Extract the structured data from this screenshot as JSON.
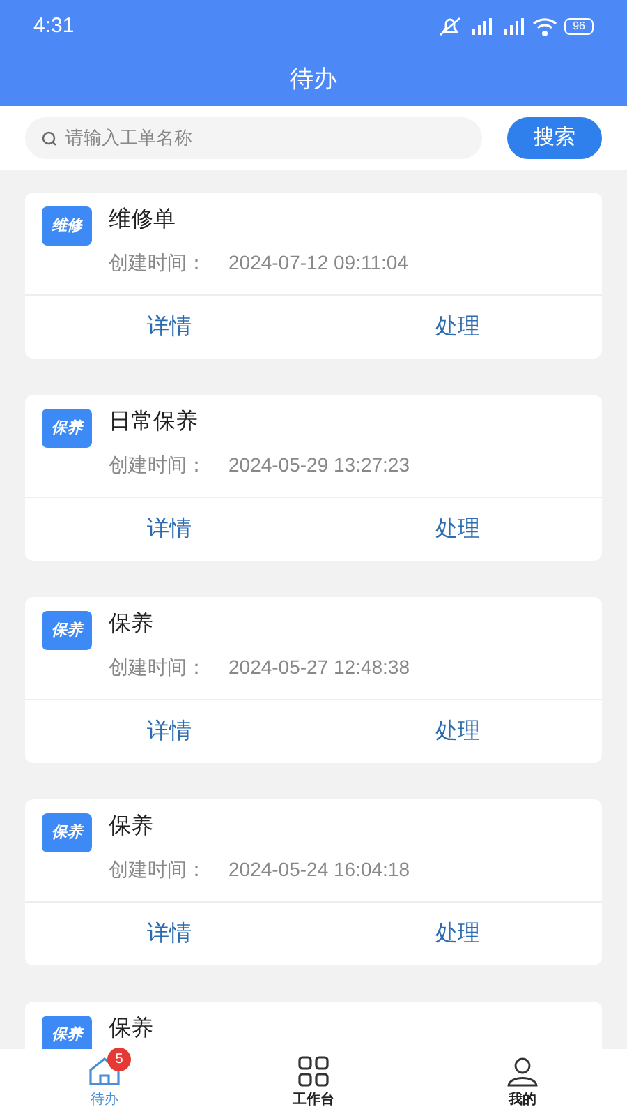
{
  "status_bar": {
    "time": "4:31",
    "battery": "96"
  },
  "header": {
    "title": "待办"
  },
  "search": {
    "placeholder": "请输入工单名称",
    "button": "搜索"
  },
  "orders": [
    {
      "badge": "维修",
      "title": "维修单",
      "created_label": "创建时间：",
      "created": "2024-07-12 09:11:04",
      "actions": [
        "详情",
        "处理"
      ]
    },
    {
      "badge": "保养",
      "title": "日常保养",
      "created_label": "创建时间：",
      "created": "2024-05-29 13:27:23",
      "actions": [
        "详情",
        "处理"
      ]
    },
    {
      "badge": "保养",
      "title": "保养",
      "created_label": "创建时间：",
      "created": "2024-05-27 12:48:38",
      "actions": [
        "详情",
        "处理"
      ]
    },
    {
      "badge": "保养",
      "title": "保养",
      "created_label": "创建时间：",
      "created": "2024-05-24 16:04:18",
      "actions": [
        "详情",
        "处理"
      ]
    },
    {
      "badge": "保养",
      "title": "保养"
    }
  ],
  "tab_bar": [
    {
      "kind": "home",
      "label": "待办",
      "selected": true,
      "count": "5"
    },
    {
      "kind": "grid",
      "label": "工作台",
      "selected": false
    },
    {
      "kind": "user",
      "label": "我的",
      "selected": false
    }
  ]
}
